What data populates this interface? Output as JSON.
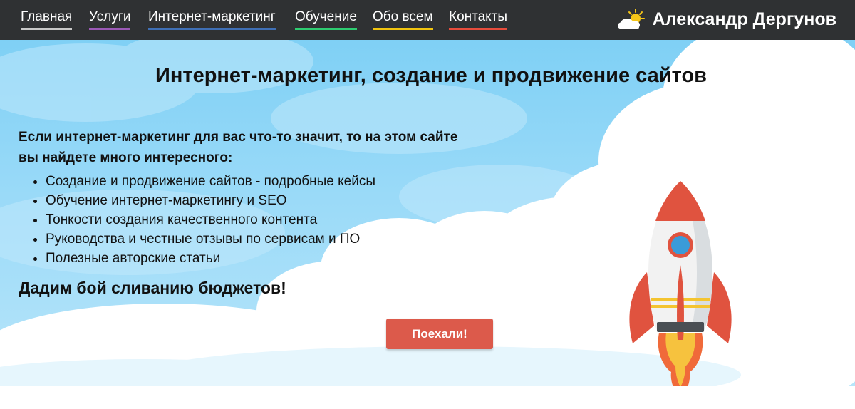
{
  "nav": {
    "items": [
      {
        "label": "Главная",
        "underline": "#c8c8c8"
      },
      {
        "label": "Услуги",
        "underline": "#9b59b6"
      },
      {
        "label": "Интернет-маркетинг",
        "underline": "#3f6fb5"
      },
      {
        "label": "Обучение",
        "underline": "#2ecc71"
      },
      {
        "label": "Обо всем",
        "underline": "#f1c40f"
      },
      {
        "label": "Контакты",
        "underline": "#e74c3c"
      }
    ]
  },
  "brand": {
    "name": "Александр Дергунов",
    "icon": "sun-cloud-icon"
  },
  "hero": {
    "title": "Интернет-маркетинг, создание и продвижение сайтов",
    "intro": "Если интернет-маркетинг для вас что-то значит, то на этом сайте вы найдете много интересного:",
    "features": [
      "Создание и продвижение сайтов - подробные кейсы",
      "Обучение интернет-маркетингу и SEO",
      "Тонкости создания качественного контента",
      "Руководства и честные отзывы по сервисам и ПО",
      "Полезные авторские статьи"
    ],
    "slogan": "Дадим бой сливанию бюджетов!",
    "cta_label": "Поехали!",
    "illustration": "rocket-icon"
  },
  "colors": {
    "topbar": "#2f3133",
    "sky": "#8fd6f7",
    "cta": "#dc5a4b",
    "rocket_red": "#e0533f",
    "rocket_window": "#3a9bd9"
  }
}
